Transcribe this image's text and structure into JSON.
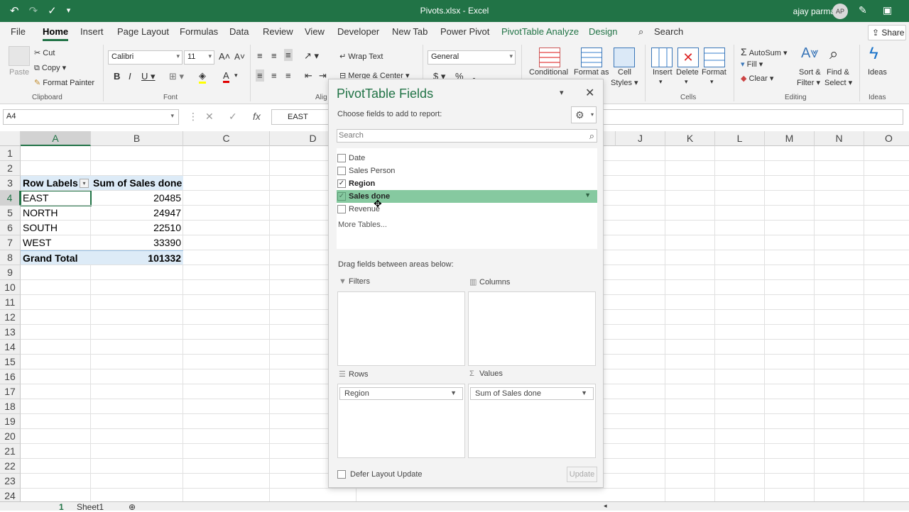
{
  "window": {
    "title": "Pivots.xlsx  -  Excel",
    "user": "ajay parmar",
    "avatar_initials": "AP"
  },
  "ribbon_tabs": [
    "File",
    "Home",
    "Insert",
    "Page Layout",
    "Formulas",
    "Data",
    "Review",
    "View",
    "Developer",
    "New Tab",
    "Power Pivot",
    "PivotTable Analyze",
    "Design"
  ],
  "active_tab": "Home",
  "search_label": "Search",
  "share_label": "Share",
  "ribbon": {
    "clipboard": {
      "paste": "Paste",
      "cut": "Cut",
      "copy": "Copy",
      "format_painter": "Format Painter",
      "group": "Clipboard"
    },
    "font": {
      "name": "Calibri",
      "size": "11",
      "group": "Font"
    },
    "alignment": {
      "wrap_text": "Wrap Text",
      "merge_center": "Merge & Center",
      "group": "Alig"
    },
    "number": {
      "format": "General"
    },
    "styles": {
      "conditional": "Conditional",
      "format_as": "Format as",
      "cell": "Cell",
      "styles": "Styles"
    },
    "cells": {
      "insert": "Insert",
      "delete": "Delete",
      "format": "Format",
      "group": "Cells"
    },
    "editing": {
      "autosum": "AutoSum",
      "fill": "Fill",
      "clear": "Clear",
      "sort1": "Sort &",
      "sort2": "Filter",
      "find1": "Find &",
      "find2": "Select",
      "group": "Editing"
    },
    "ideas": {
      "label": "Ideas",
      "group": "Ideas"
    }
  },
  "formula_bar": {
    "name_box": "A4",
    "value": "EAST"
  },
  "grid": {
    "columns": [
      "A",
      "B",
      "C",
      "D",
      "J",
      "K",
      "L",
      "M",
      "N",
      "O"
    ],
    "rows": [
      "1",
      "2",
      "3",
      "4",
      "5",
      "6",
      "7",
      "8",
      "9",
      "10",
      "11",
      "12",
      "13",
      "14",
      "15",
      "16",
      "17",
      "18",
      "19",
      "20",
      "21",
      "22",
      "23",
      "24"
    ],
    "pivot_header": {
      "row_labels": "Row Labels",
      "sum_label": "Sum of Sales done"
    },
    "pivot_rows": [
      {
        "label": "EAST",
        "value": "20485"
      },
      {
        "label": "NORTH",
        "value": "24947"
      },
      {
        "label": "SOUTH",
        "value": "22510"
      },
      {
        "label": "WEST",
        "value": "33390"
      }
    ],
    "grand_total": {
      "label": "Grand Total",
      "value": "101332"
    }
  },
  "sheet_tabs": {
    "page": "1",
    "sheet": "Sheet1"
  },
  "pivot_panel": {
    "title": "PivotTable Fields",
    "choose": "Choose fields to add to report:",
    "search_placeholder": "Search",
    "fields": [
      {
        "name": "Date",
        "checked": false
      },
      {
        "name": "Sales Person",
        "checked": false
      },
      {
        "name": "Region",
        "checked": true
      },
      {
        "name": "Sales done",
        "checked": true
      },
      {
        "name": "Revenue",
        "checked": false
      }
    ],
    "more_tables": "More Tables...",
    "drag_label": "Drag fields between areas below:",
    "areas": {
      "filters": "Filters",
      "columns": "Columns",
      "rows": "Rows",
      "values": "Values",
      "rows_field": "Region",
      "values_field": "Sum of Sales done"
    },
    "defer": "Defer Layout Update",
    "update": "Update"
  },
  "colors": {
    "excel_green": "#217346",
    "pivot_header_bg": "#ddebf7",
    "field_highlight": "#86c9a0"
  }
}
